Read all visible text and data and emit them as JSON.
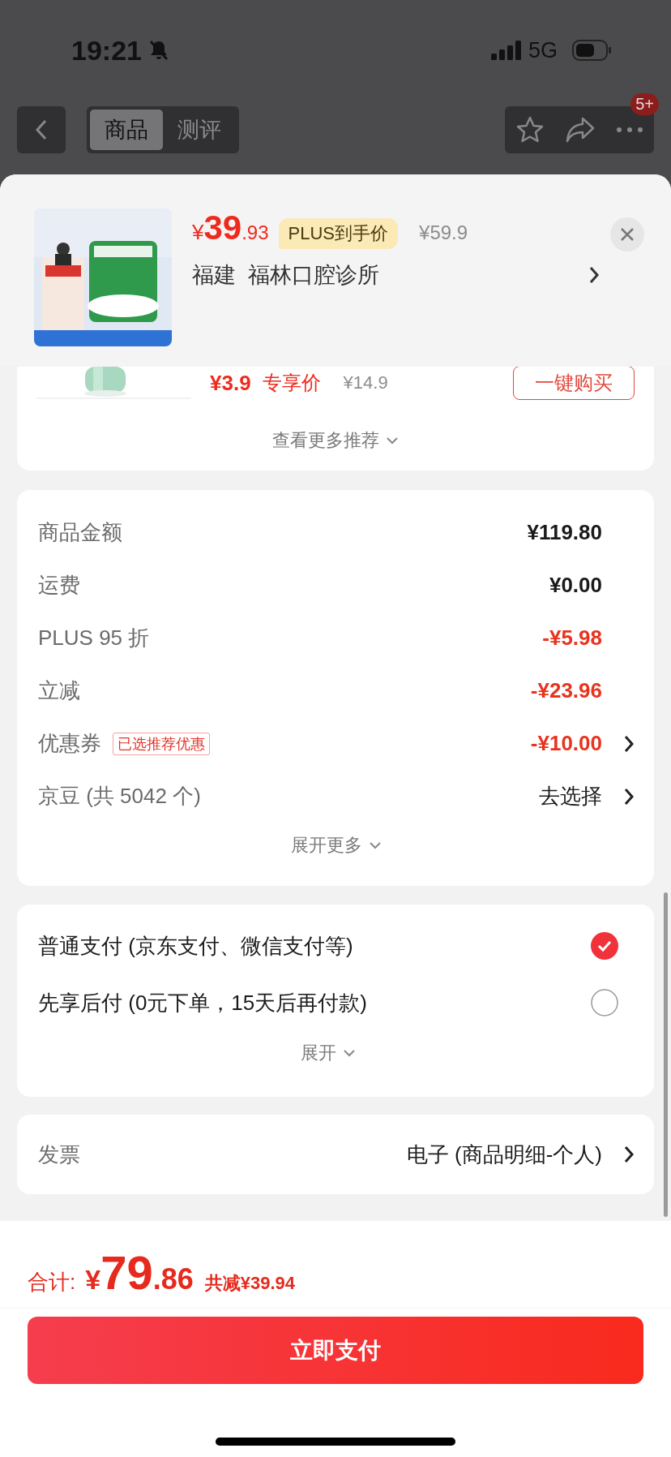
{
  "status_bar": {
    "time": "19:21",
    "network": "5G"
  },
  "nav": {
    "tabs": [
      {
        "label": "商品",
        "selected": true
      },
      {
        "label": "测评",
        "selected": false
      }
    ],
    "badge": "5+"
  },
  "product": {
    "currency": "¥",
    "price_int": "39",
    "price_dec": ".93",
    "tag": "PLUS到手价",
    "original_price": "¥59.9",
    "address": "福建  福林口腔诊所"
  },
  "recommendation": {
    "price": "¥3.9",
    "price_label": "专享价",
    "original_price": "¥14.9",
    "button": "一键购买",
    "more": "查看更多推荐"
  },
  "summary": {
    "rows": [
      {
        "label": "商品金额",
        "value": "¥119.80",
        "kind": "plain",
        "link": false
      },
      {
        "label": "运费",
        "value": "¥0.00",
        "kind": "plain",
        "link": false
      },
      {
        "label": "PLUS 95 折",
        "value": "-¥5.98",
        "kind": "discount",
        "link": false
      },
      {
        "label": "立减",
        "value": "-¥23.96",
        "kind": "discount",
        "link": false
      },
      {
        "label": "优惠券",
        "tag": "已选推荐优惠",
        "value": "-¥10.00",
        "kind": "discount",
        "link": true
      },
      {
        "label": "京豆 (共 5042 个)",
        "value": "去选择",
        "kind": "action",
        "link": true
      }
    ],
    "more": "展开更多"
  },
  "payment": {
    "options": [
      {
        "label": "普通支付 (京东支付、微信支付等)",
        "selected": true
      },
      {
        "label": "先享后付 (0元下单，15天后再付款)",
        "selected": false
      }
    ],
    "more": "展开"
  },
  "invoice": {
    "label": "发票",
    "value": "电子 (商品明细-个人)"
  },
  "footer": {
    "total_label": "合计:",
    "currency": "¥",
    "total_int": "79",
    "total_dec": ".86",
    "saved": "共减¥39.94",
    "button": "立即支付"
  }
}
